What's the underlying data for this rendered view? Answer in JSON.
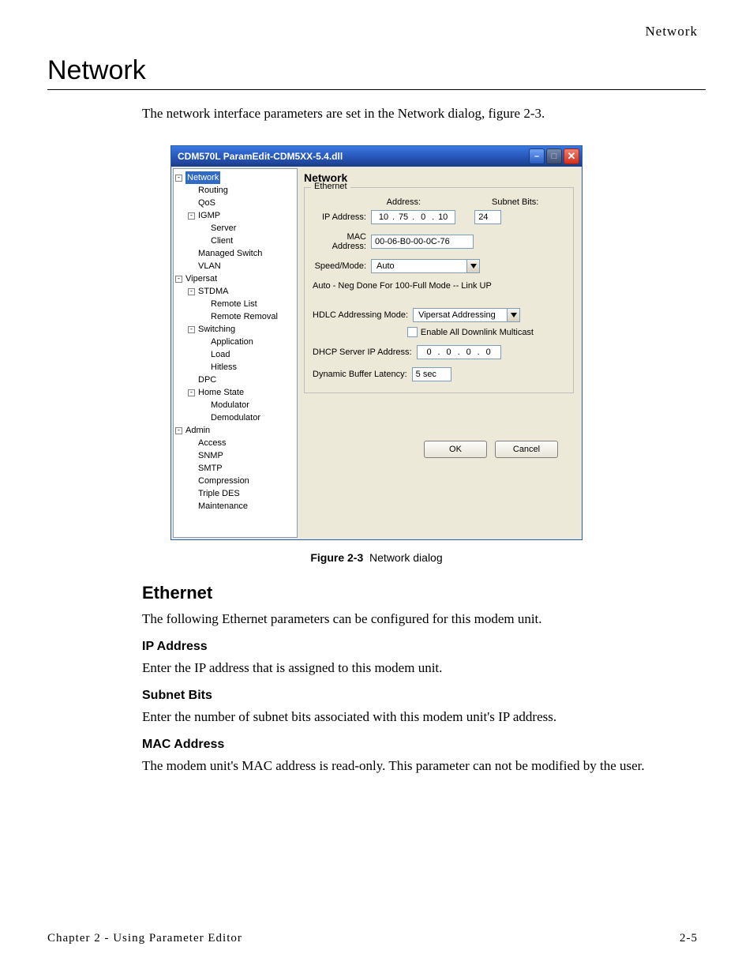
{
  "header": {
    "right": "Network"
  },
  "title": "Network",
  "intro": "The network interface parameters are set in the Network dialog, figure 2-3.",
  "dialog": {
    "title": "CDM570L ParamEdit-CDM5XX-5.4.dll",
    "tree": [
      {
        "lvl": 0,
        "exp": "-",
        "label": "Network",
        "sel": true
      },
      {
        "lvl": 1,
        "label": "Routing"
      },
      {
        "lvl": 1,
        "label": "QoS"
      },
      {
        "lvl": 1,
        "exp": "-",
        "label": "IGMP"
      },
      {
        "lvl": 2,
        "label": "Server"
      },
      {
        "lvl": 2,
        "label": "Client"
      },
      {
        "lvl": 1,
        "label": "Managed Switch"
      },
      {
        "lvl": 1,
        "label": "VLAN"
      },
      {
        "lvl": 0,
        "exp": "-",
        "label": "Vipersat"
      },
      {
        "lvl": 1,
        "exp": "-",
        "label": "STDMA"
      },
      {
        "lvl": 2,
        "label": "Remote List"
      },
      {
        "lvl": 2,
        "label": "Remote Removal"
      },
      {
        "lvl": 1,
        "exp": "-",
        "label": "Switching"
      },
      {
        "lvl": 2,
        "label": "Application"
      },
      {
        "lvl": 2,
        "label": "Load"
      },
      {
        "lvl": 2,
        "label": "Hitless"
      },
      {
        "lvl": 1,
        "label": "DPC"
      },
      {
        "lvl": 1,
        "exp": "-",
        "label": "Home State"
      },
      {
        "lvl": 2,
        "label": "Modulator"
      },
      {
        "lvl": 2,
        "label": "Demodulator"
      },
      {
        "lvl": 0,
        "exp": "-",
        "label": "Admin"
      },
      {
        "lvl": 1,
        "label": "Access"
      },
      {
        "lvl": 1,
        "label": "SNMP"
      },
      {
        "lvl": 1,
        "label": "SMTP"
      },
      {
        "lvl": 1,
        "label": "Compression"
      },
      {
        "lvl": 1,
        "label": "Triple DES"
      },
      {
        "lvl": 1,
        "label": "Maintenance"
      }
    ],
    "panel": {
      "heading": "Network",
      "group": "Ethernet",
      "addr_label": "Address:",
      "subnet_label": "Subnet Bits:",
      "ip_label": "IP Address:",
      "ip": [
        "10",
        "75",
        "0",
        "10"
      ],
      "subnet_bits": "24",
      "mac_label": "MAC Address:",
      "mac": "00-06-B0-00-0C-76",
      "speed_label": "Speed/Mode:",
      "speed_value": "Auto",
      "neg_status": "Auto - Neg Done For 100-Full Mode -- Link UP",
      "hdlc_label": "HDLC Addressing Mode:",
      "hdlc_value": "Vipersat Addressing",
      "enable_multicast": "Enable All Downlink Multicast",
      "dhcp_label": "DHCP Server IP Address:",
      "dhcp_ip": [
        "0",
        "0",
        "0",
        "0"
      ],
      "buf_label": "Dynamic Buffer Latency:",
      "buf_value": "5 sec",
      "ok": "OK",
      "cancel": "Cancel"
    }
  },
  "caption": {
    "bold": "Figure 2-3",
    "rest": "Network dialog"
  },
  "sections": {
    "ethernet_h": "Ethernet",
    "ethernet_p": "The following Ethernet parameters can be configured for this modem unit.",
    "ipaddr_h": "IP Address",
    "ipaddr_p": "Enter the IP address that is assigned to this modem unit.",
    "subnet_h": "Subnet Bits",
    "subnet_p": "Enter the number of subnet bits associated with this modem unit's IP address.",
    "mac_h": "MAC Address",
    "mac_p": "The modem unit's MAC address is read-only. This parameter can not be modified by the user."
  },
  "footer": {
    "left": "Chapter 2 - Using Parameter Editor",
    "right": "2-5"
  }
}
